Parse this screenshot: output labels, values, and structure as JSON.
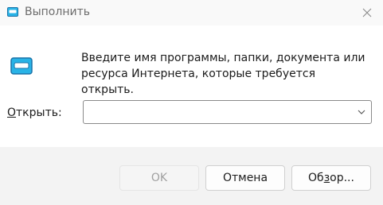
{
  "window": {
    "title": "Выполнить",
    "close_label": "✕"
  },
  "dialog": {
    "description": "Введите имя программы, папки, документа или ресурса Интернета, которые требуется открыть.",
    "open_label_accel": "О",
    "open_label_rest": "ткрыть:",
    "input_value": ""
  },
  "buttons": {
    "ok": "OK",
    "cancel": "Отмена",
    "browse_before": "Об",
    "browse_accel": "з",
    "browse_after": "ор..."
  },
  "colors": {
    "accent": "#29b3e6",
    "icon_dark": "#1a73a8"
  },
  "icons": {
    "title": "run-icon",
    "main": "run-icon",
    "close": "close-icon",
    "dropdown": "chevron-down-icon"
  }
}
